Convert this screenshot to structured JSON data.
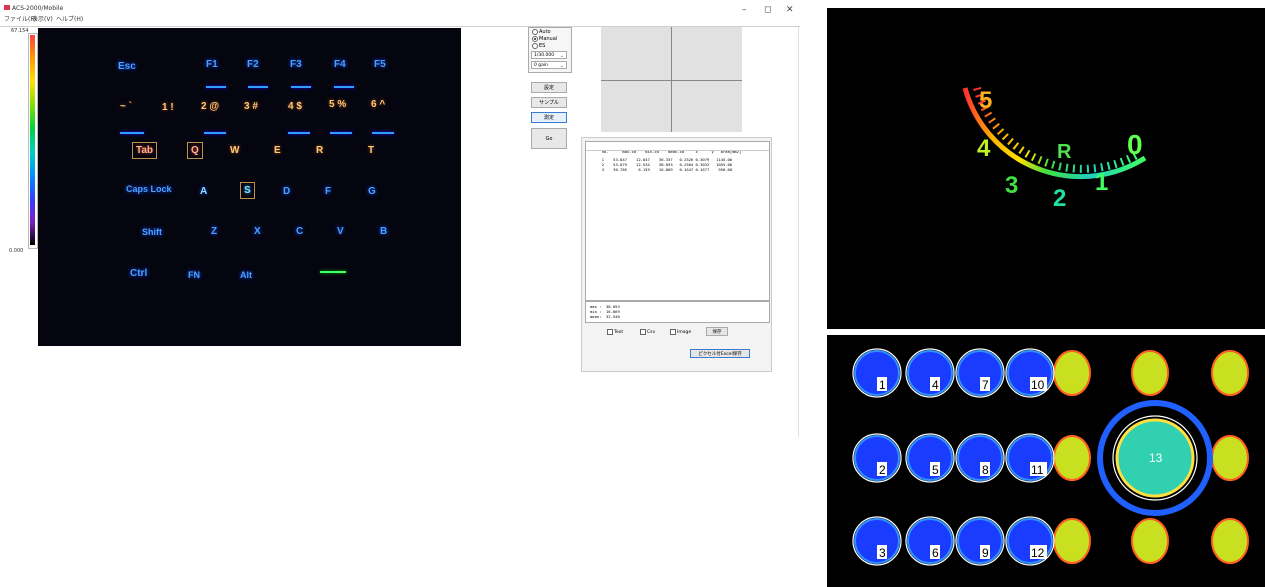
{
  "window": {
    "title": "ACS-2000/Mobile",
    "menu": [
      "ファイル(F)",
      "表示(V)",
      "ヘルプ(H)"
    ],
    "controls": {
      "minimize": "–",
      "maximize": "◻",
      "close": "✕"
    }
  },
  "colorbar": {
    "max": "67.154",
    "min": "0.000"
  },
  "keyboard": {
    "row1": [
      "Esc",
      "F1",
      "F2",
      "F3",
      "F4",
      "F5"
    ],
    "row2": [
      "~ `",
      "1 !",
      "2 @",
      "3 #",
      "4 $",
      "5 %",
      "6 ^"
    ],
    "row3": [
      "Tab",
      "Q",
      "W",
      "E",
      "R",
      "T"
    ],
    "row4": [
      "Caps Lock",
      "A",
      "S",
      "D",
      "F",
      "G"
    ],
    "row5": [
      "Shift",
      "Z",
      "X",
      "C",
      "V",
      "B"
    ],
    "row6": [
      "Ctrl",
      "FN",
      "Alt"
    ]
  },
  "controls": {
    "mode_options": [
      "Auto",
      "Manual",
      "ES"
    ],
    "mode_selected": "Manual",
    "shutter": "1/30.000",
    "gain": "0 gain",
    "settings_button": "設定",
    "sample_button": "サンプル",
    "measure_button": "測定",
    "go_button": "Go"
  },
  "results": {
    "columns": [
      "no.",
      "max-cd",
      "min-cd",
      "mean-cd",
      "x",
      "y",
      "area[mm2]"
    ],
    "rows": [
      [
        "1",
        "53.847",
        "12.847",
        "36.357",
        "0.2526",
        "0.3079",
        "1145.00"
      ],
      [
        "2",
        "53.079",
        "12.534",
        "38.093",
        "0.2504",
        "0.3032",
        "1055.00"
      ],
      [
        "3",
        "30.785",
        "6.159",
        "16.869",
        "0.1647",
        "0.1677",
        "950.00"
      ]
    ],
    "stats": {
      "max_label": "max :",
      "max": "38.093",
      "min_label": "min :",
      "min": "16.869",
      "mean_label": "mean:",
      "mean": "32.540"
    },
    "checkboxes": [
      "Text",
      "Csv",
      "Image"
    ],
    "save_button": "保存",
    "excel_button": "ピクセル付Excel保存"
  },
  "dashboard": {
    "gear_labels": [
      "5",
      "4",
      "3",
      "2",
      "1",
      "0",
      "R"
    ]
  },
  "buttons_panel": {
    "labels": [
      "1",
      "2",
      "3",
      "4",
      "5",
      "6",
      "7",
      "8",
      "9",
      "10",
      "11",
      "12",
      "13"
    ]
  },
  "colors": {
    "accent": "#3a7bd5",
    "thermal_bg": "#050510"
  }
}
